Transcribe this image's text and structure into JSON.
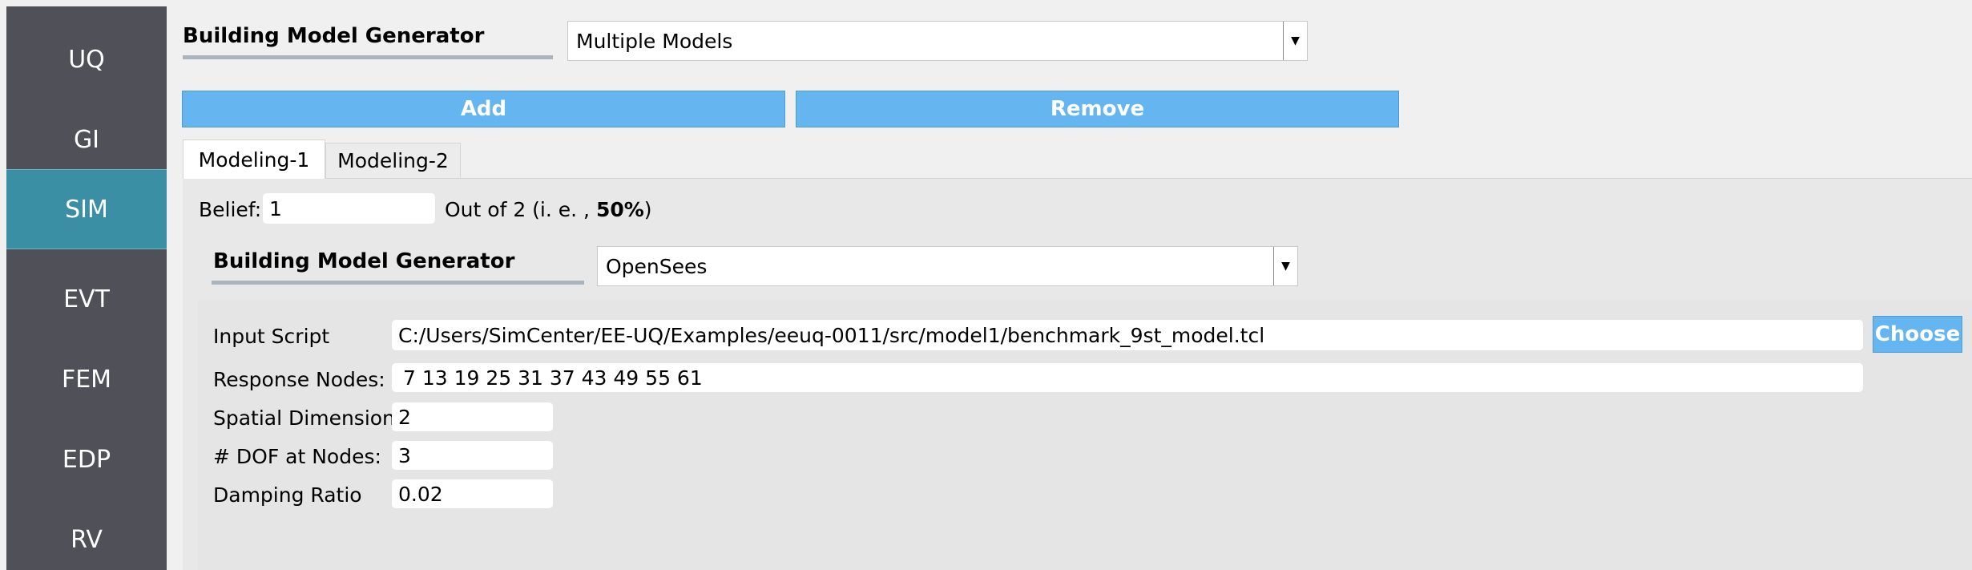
{
  "sidebar": {
    "items": [
      {
        "label": "UQ"
      },
      {
        "label": "GI"
      },
      {
        "label": "SIM"
      },
      {
        "label": "EVT"
      },
      {
        "label": "FEM"
      },
      {
        "label": "EDP"
      },
      {
        "label": "RV"
      }
    ],
    "active": "SIM"
  },
  "header": {
    "title": "Building Model Generator",
    "generator_selected": "Multiple Models"
  },
  "buttons": {
    "add": "Add",
    "remove": "Remove",
    "choose": "Choose"
  },
  "tabs": [
    {
      "label": "Modeling-1",
      "active": true
    },
    {
      "label": "Modeling-2",
      "active": false
    }
  ],
  "belief": {
    "label": "Belief:",
    "value": "1",
    "out_of_prefix": "Out of 2 (i. e. ,",
    "percent": "50%",
    "suffix": ")"
  },
  "sub_model": {
    "title": "Building Model Generator",
    "generator_selected": "OpenSees"
  },
  "opensees": {
    "input_script_label": "Input Script",
    "input_script_value": "C:/Users/SimCenter/EE-UQ/Examples/eeuq-0011/src/model1/benchmark_9st_model.tcl",
    "response_nodes_label": "Response Nodes:",
    "response_nodes_value": "7 13 19 25 31 37 43 49 55 61",
    "spatial_dim_label": "Spatial Dimension:",
    "spatial_dim_value": "2",
    "dof_label": "# DOF at Nodes:",
    "dof_value": "3",
    "damping_label": "Damping Ratio",
    "damping_value": "0.02"
  },
  "colors": {
    "sidebar_bg": "#505158",
    "sidebar_active": "#3a8fa5",
    "button_bg": "#64b5f0"
  }
}
